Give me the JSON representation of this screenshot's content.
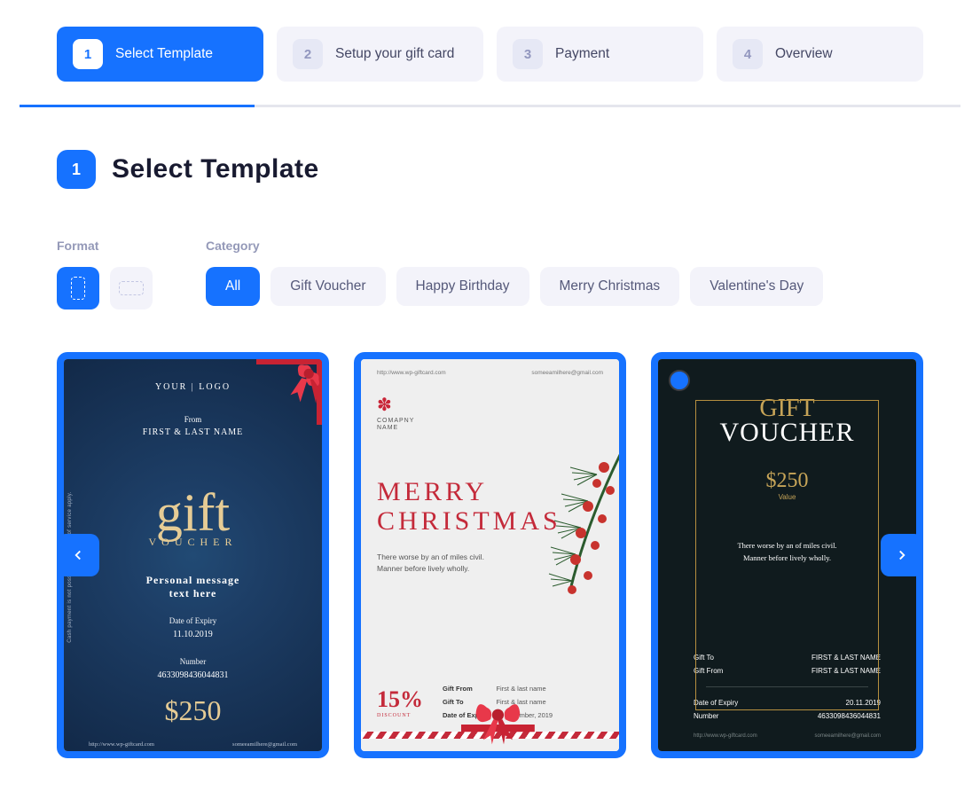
{
  "wizard": {
    "steps": [
      {
        "num": "1",
        "label": "Select Template"
      },
      {
        "num": "2",
        "label": "Setup your gift card"
      },
      {
        "num": "3",
        "label": "Payment"
      },
      {
        "num": "4",
        "label": "Overview"
      }
    ]
  },
  "section": {
    "num": "1",
    "title": "Select Template"
  },
  "filters": {
    "format_label": "Format",
    "category_label": "Category",
    "categories": [
      "All",
      "Gift Voucher",
      "Happy Birthday",
      "Merry Christmas",
      "Valentine's Day"
    ]
  },
  "card1": {
    "logo": "YOUR | LOGO",
    "from_lbl": "From",
    "from_name": "FIRST & LAST NAME",
    "gift_word": "gift",
    "voucher_word": "VOUCHER",
    "msg1": "Personal message",
    "msg2": "text here",
    "expiry_lbl": "Date of Expiry",
    "expiry_val": "11.10.2019",
    "number_lbl": "Number",
    "number_val": "4633098436044831",
    "price": "$250",
    "side_text": "Cash payment is not possible. The terms of service apply.",
    "foot_url": "http://www.wp-giftcard.com",
    "foot_email": "someeamilhere@gmail.com"
  },
  "card2": {
    "top_url": "http://www.wp-giftcard.com",
    "top_email": "someeamilhere@gmail.com",
    "company_lbl1": "COMAPNY",
    "company_lbl2": "NAME",
    "headline1": "MERRY",
    "headline2": "CHRISTMAS",
    "sub1": "There worse by an of miles civil.",
    "sub2": "Manner before lively wholly.",
    "discount_pct": "15%",
    "discount_lbl": "DISCOUNT",
    "gift_from_lbl": "Gift From",
    "gift_from_val": "First & last name",
    "gift_to_lbl": "Gift To",
    "gift_to_val": "First & last name",
    "expiry_lbl": "Date of Expiry",
    "expiry_val": "11 november, 2019"
  },
  "card3": {
    "gift_word": "GIFT",
    "voucher_word": "VOUCHER",
    "amount": "$250",
    "value_lbl": "Value",
    "sub1": "There worse by an of miles civil.",
    "sub2": "Manner before lively wholly.",
    "gift_to_lbl": "Gift To",
    "gift_to_val": "FIRST & LAST NAME",
    "gift_from_lbl": "Gift From",
    "gift_from_val": "FIRST & LAST NAME",
    "expiry_lbl": "Date of Expiry",
    "expiry_val": "20.11.2019",
    "number_lbl": "Number",
    "number_val": "4633098436044831",
    "foot_url": "http://www.wp-giftcard.com",
    "foot_email": "someeamilhere@gmail.com"
  }
}
